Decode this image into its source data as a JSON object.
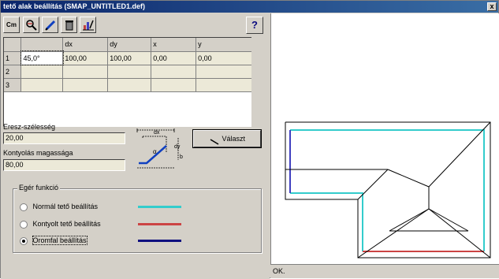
{
  "window": {
    "title": "tető alak beállítás (SMAP_UNTITLED1.def)",
    "close_glyph": "x"
  },
  "toolbar": {
    "cm_label": "Cm",
    "help_label": "?"
  },
  "table": {
    "columns": [
      "",
      "",
      "dx",
      "dy",
      "x",
      "y"
    ],
    "rows": [
      [
        "1",
        "45,0°",
        "100,00",
        "100,00",
        "0,00",
        "0,00"
      ],
      [
        "2",
        "",
        "",
        "",
        "",
        ""
      ],
      [
        "3",
        "",
        "",
        "",
        "",
        ""
      ]
    ]
  },
  "form": {
    "eresz_label": "Eresz-szélesség",
    "eresz_value": "20,00",
    "kontyolas_label": "Kontyolás magassága",
    "kontyolas_value": "80,00",
    "action_button": "Választ"
  },
  "diagram": {
    "dx_label": "dx",
    "dy_label": "dy",
    "alpha_label": "α",
    "b_label": "b"
  },
  "mouse_functions": {
    "title": "Egér funkció",
    "options": [
      {
        "label": "Normál tető beállítás",
        "selected": false,
        "color": "#33cccc"
      },
      {
        "label": "Kontyolt tető beállítás",
        "selected": false,
        "color": "#cc4444"
      },
      {
        "label": "Oromfal beállítás",
        "selected": true,
        "color": "#101080"
      }
    ]
  },
  "status": {
    "text": "OK."
  }
}
